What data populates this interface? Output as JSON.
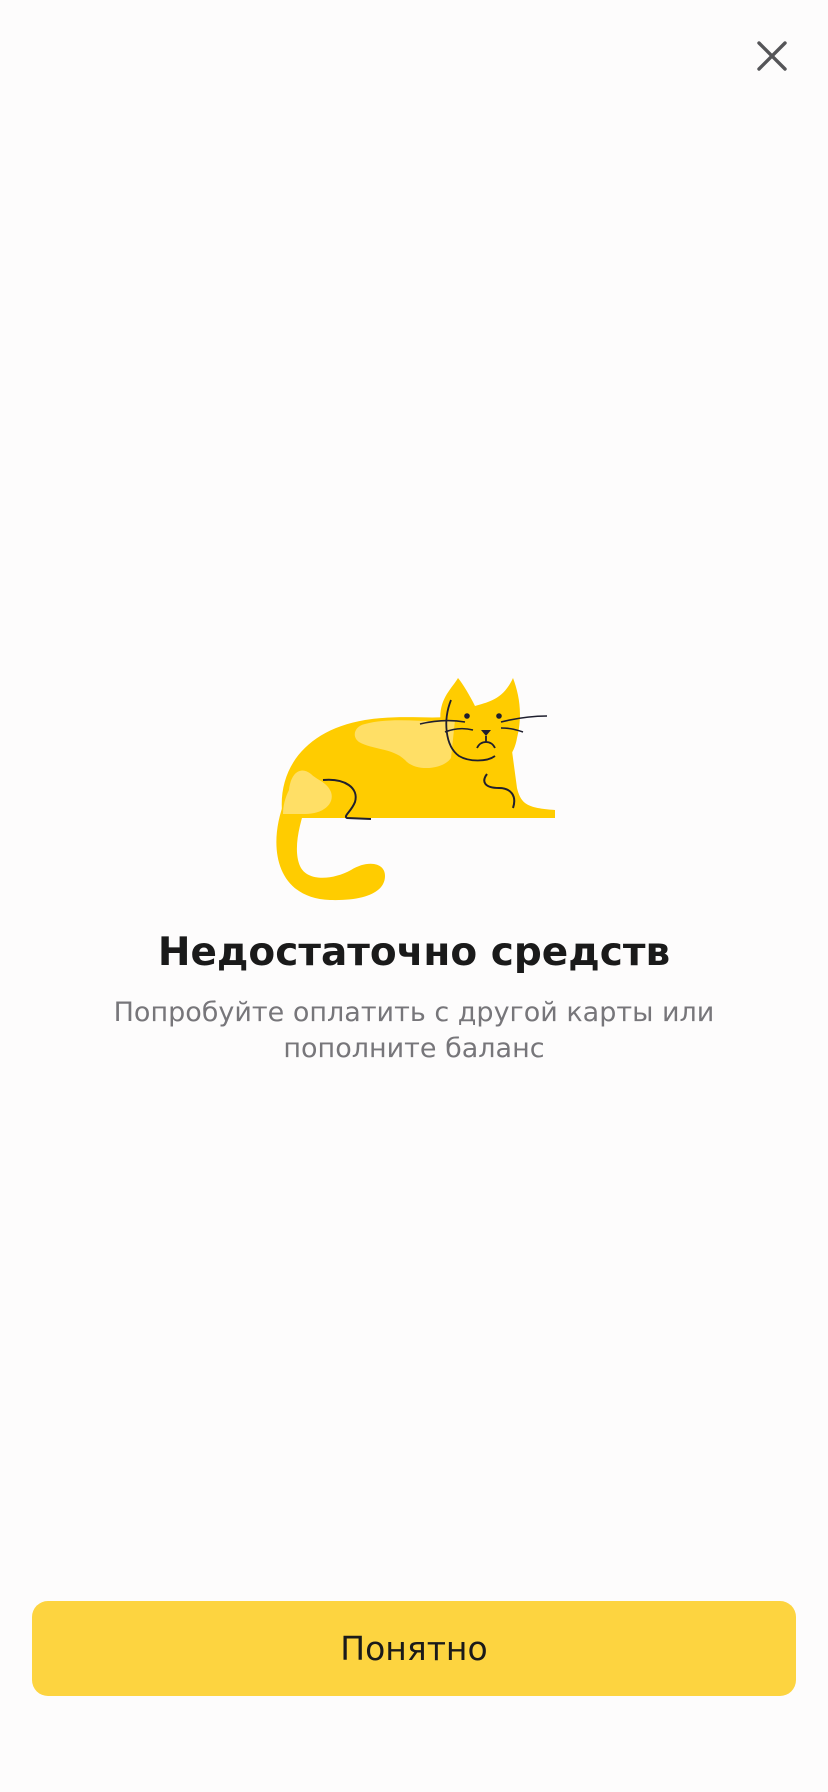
{
  "dialog": {
    "close_icon": "close-icon",
    "illustration": "sad-cat-illustration",
    "title": "Недостаточно средств",
    "message": "Попробуйте оплатить с другой карты или пополните баланс",
    "confirm_label": "Понятно"
  },
  "colors": {
    "accent": "#fdd440",
    "cat_body": "#ffcc00",
    "cat_spots": "#ffdf66",
    "title_text": "#1a1a1a",
    "secondary_text": "#77767a",
    "background": "#fdfcfc"
  }
}
